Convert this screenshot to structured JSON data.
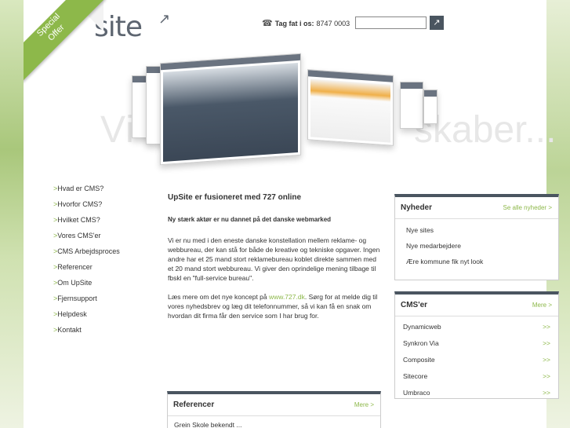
{
  "ribbon": {
    "line1": "Special",
    "line2": "Offer"
  },
  "logo": {
    "text": "site",
    "arrow": "↗"
  },
  "contact": {
    "label": "Tag fat i os:",
    "phone": "8747 0003"
  },
  "search": {
    "value": "",
    "button": "↗"
  },
  "hero": {
    "left_text": "Vi",
    "right_text": "skaber..."
  },
  "nav": {
    "items": [
      "Hvad er CMS?",
      "Hvorfor CMS?",
      "Hvilket CMS?",
      "Vores CMS'er",
      "CMS Arbejdsproces",
      "Referencer",
      "Om UpSite",
      "Fjernsupport",
      "Helpdesk",
      "Kontakt"
    ]
  },
  "main": {
    "title": "UpSite er fusioneret med 727 online",
    "lead": "Ny stærk aktør er nu dannet på det danske webmarked",
    "para1": "Vi er nu med i den eneste danske konstellation mellem reklame- og webbureau, der kan stå for både de kreative og tekniske opgaver. Ingen andre har et 25 mand stort reklamebureau koblet direkte sammen med et 20 mand stort webbureau. Vi giver den oprindelige mening tilbage til fbskl en \"full-service bureau\".",
    "para2_prefix": "Læs mere om det nye koncept på ",
    "para2_link": "www.727.dk",
    "para2_suffix": ". Sørg for at melde dig til vores nyhedsbrev og læg dit telefonnummer, så vi kan få en snak om hvordan dit firma får den service som I har brug for."
  },
  "news": {
    "title": "Nyheder",
    "more": "Se alle nyheder >",
    "items": [
      "Nye sites",
      "Nye medarbejdere",
      "Ære kommune fik nyt look"
    ]
  },
  "cms": {
    "title": "CMS'er",
    "more": "Mere >",
    "items": [
      "Dynamicweb",
      "Synkron Via",
      "Composite",
      "Sitecore",
      "Umbraco"
    ],
    "arrow": ">>"
  },
  "refs": {
    "title": "Referencer",
    "more": "Mere >",
    "cut": "Grein Skole bekendt ..."
  },
  "colors": {
    "accent": "#8db84a",
    "dark": "#4a5560"
  }
}
